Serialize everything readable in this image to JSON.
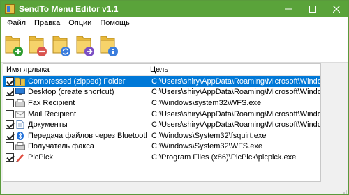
{
  "window": {
    "title": "SendTo Menu Editor v1.1"
  },
  "menu": [
    {
      "label": "Файл"
    },
    {
      "label": "Правка"
    },
    {
      "label": "Опции"
    },
    {
      "label": "Помощь"
    }
  ],
  "toolbar": [
    {
      "icon": "folder-add-icon",
      "color": "#2e9b2e"
    },
    {
      "icon": "folder-remove-icon",
      "color": "#d9534f"
    },
    {
      "icon": "folder-refresh-icon",
      "color": "#3b7ddd"
    },
    {
      "icon": "folder-arrow-icon",
      "color": "#7b4fc4"
    },
    {
      "icon": "folder-info-icon",
      "color": "#3b7ddd"
    }
  ],
  "list": {
    "columns": [
      "Имя ярлыка",
      "Цель"
    ],
    "rows": [
      {
        "name": "Compressed (zipped) Folder",
        "target": "C:\\Users\\shiry\\AppData\\Roaming\\Microsoft\\Windows\\Sen...",
        "checked": true,
        "selected": true,
        "icon": "zip-folder-icon"
      },
      {
        "name": "Desktop (create shortcut)",
        "target": "C:\\Users\\shiry\\AppData\\Roaming\\Microsoft\\Windows\\Sen...",
        "checked": true,
        "selected": false,
        "icon": "desktop-icon"
      },
      {
        "name": "Fax Recipient",
        "target": "C:\\Windows\\system32\\WFS.exe",
        "checked": false,
        "selected": false,
        "icon": "fax-icon"
      },
      {
        "name": "Mail Recipient",
        "target": "C:\\Users\\shiry\\AppData\\Roaming\\Microsoft\\Windows\\Sen...",
        "checked": false,
        "selected": false,
        "icon": "mail-icon"
      },
      {
        "name": "Документы",
        "target": "C:\\Users\\shiry\\AppData\\Roaming\\Microsoft\\Windows\\Sen...",
        "checked": true,
        "selected": false,
        "icon": "documents-icon"
      },
      {
        "name": "Передача файлов через Bluetooth",
        "target": "C:\\Windows\\System32\\fsquirt.exe",
        "checked": true,
        "selected": false,
        "icon": "bluetooth-icon"
      },
      {
        "name": "Получатель факса",
        "target": "C:\\Windows\\System32\\WFS.exe",
        "checked": false,
        "selected": false,
        "icon": "fax-icon"
      },
      {
        "name": "PicPick",
        "target": "C:\\Program Files (x86)\\PicPick\\picpick.exe",
        "checked": true,
        "selected": false,
        "icon": "picpick-icon"
      }
    ]
  },
  "colors": {
    "titlebar": "#5aa33a",
    "selection": "#0078d7"
  }
}
